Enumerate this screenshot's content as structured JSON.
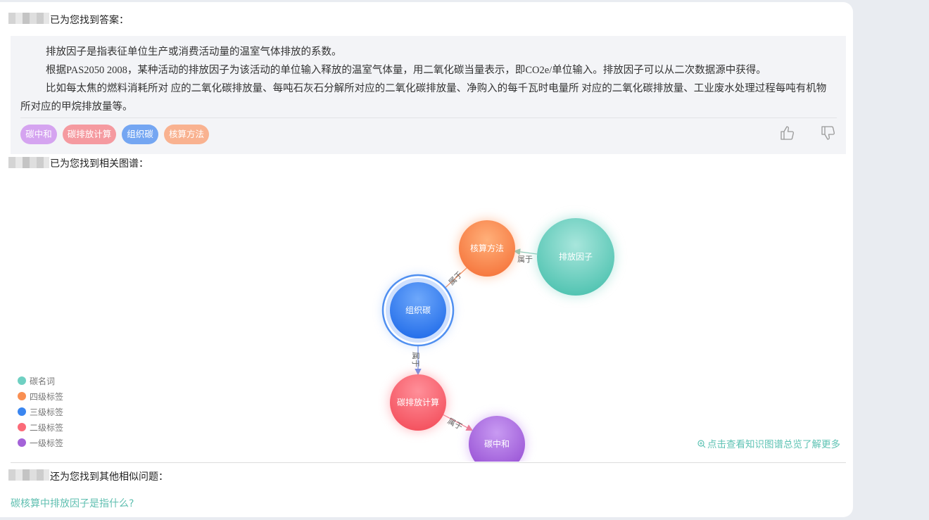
{
  "answer_section": {
    "heading": "已为您找到答案：",
    "paragraphs": [
      "排放因子是指表征单位生产或消费活动量的温室气体排放的系数。",
      "根据PAS2050 2008，某种活动的排放因子为该活动的单位输入释放的温室气体量，用二氧化碳当量表示，即CO2e/单位输入。排放因子可以从二次数据源中获得。",
      "比如每太焦的燃料消耗所对 应的二氧化碳排放量、每吨石灰石分解所对应的二氧化碳排放量、净购入的每千瓦时电量所 对应的二氧化碳排放量、工业废水处理过程每吨有机物所对应的甲烷排放量等。"
    ],
    "tags": [
      {
        "label": "碳中和",
        "color": "#d5a4f0"
      },
      {
        "label": "碳排放计算",
        "color": "#f59aa0"
      },
      {
        "label": "组织碳",
        "color": "#74a6f2"
      },
      {
        "label": "核算方法",
        "color": "#f9b290"
      }
    ],
    "like_icon": "thumbs-up-icon",
    "dislike_icon": "thumbs-down-icon"
  },
  "graph_section": {
    "heading": "已为您找到相关图谱：",
    "nodes": [
      {
        "label": "核算方法",
        "category": "四级标签"
      },
      {
        "label": "排放因子",
        "category": "碳名词"
      },
      {
        "label": "组织碳",
        "category": "三级标签"
      },
      {
        "label": "碳排放计算",
        "category": "二级标签"
      },
      {
        "label": "碳中和",
        "category": "一级标签"
      }
    ],
    "edges": [
      {
        "source": "排放因子",
        "target": "核算方法",
        "label": "属于"
      },
      {
        "source": "核算方法",
        "target": "组织碳",
        "label": "属于"
      },
      {
        "source": "组织碳",
        "target": "碳排放计算",
        "label": "属于"
      },
      {
        "source": "碳排放计算",
        "target": "碳中和",
        "label": "属于"
      }
    ],
    "legend": [
      {
        "label": "碳名词",
        "color": "#6fd0c2"
      },
      {
        "label": "四级标签",
        "color": "#f98f52"
      },
      {
        "label": "三级标签",
        "color": "#3a86f0"
      },
      {
        "label": "二级标签",
        "color": "#fb6a78"
      },
      {
        "label": "一级标签",
        "color": "#a463d8"
      }
    ],
    "more_link": "点击查看知识图谱总览了解更多"
  },
  "similar_section": {
    "heading": "还为您找到其他相似问题：",
    "questions": [
      "碳核算中排放因子是指什么?"
    ]
  }
}
